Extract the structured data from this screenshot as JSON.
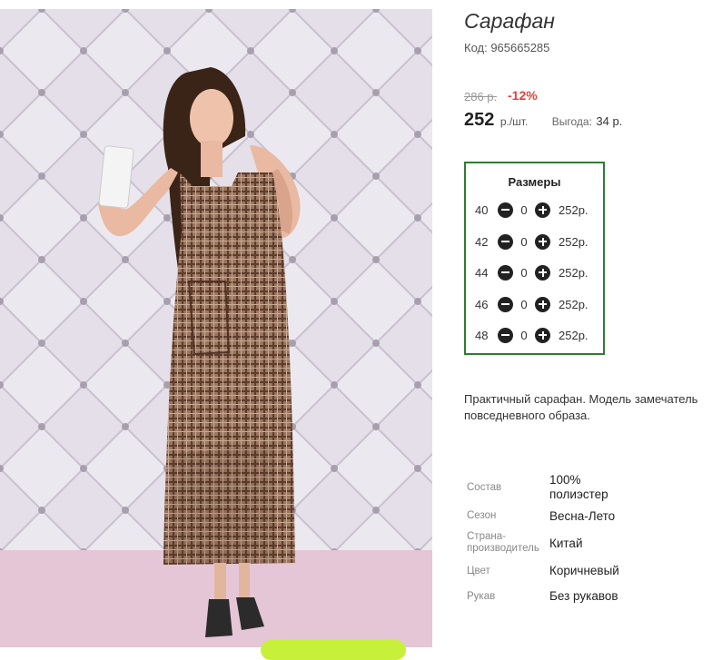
{
  "product": {
    "title": "Сарафан",
    "code": "Код: 965665285",
    "old_price": "286 р.",
    "discount": "-12%",
    "price": "252",
    "price_unit": "р./шт.",
    "benefit_label": "Выгода:",
    "benefit_value": "34 р.",
    "image_alt": "Женщина в клетчатом сарафане",
    "colors": {
      "border_green": "#2e7d32",
      "discount_red": "#e8413a",
      "button_lime": "#c6f03a"
    }
  },
  "sizes": {
    "title": "Размеры",
    "rows": [
      {
        "size": "40",
        "qty": "0",
        "price": "252р."
      },
      {
        "size": "42",
        "qty": "0",
        "price": "252р."
      },
      {
        "size": "44",
        "qty": "0",
        "price": "252р."
      },
      {
        "size": "46",
        "qty": "0",
        "price": "252р."
      },
      {
        "size": "48",
        "qty": "0",
        "price": "252р."
      }
    ]
  },
  "description": "Практичный сарафан. Модель замечатель повседневного образа.",
  "specs": [
    {
      "label": "Состав",
      "value": "100% полиэстер"
    },
    {
      "label": "Сезон",
      "value": "Весна-Лето"
    },
    {
      "label": "Страна-производитель",
      "value": "Китай"
    },
    {
      "label": "Цвет",
      "value": "Коричневый"
    },
    {
      "label": "Рукав",
      "value": "Без рукавов"
    }
  ]
}
